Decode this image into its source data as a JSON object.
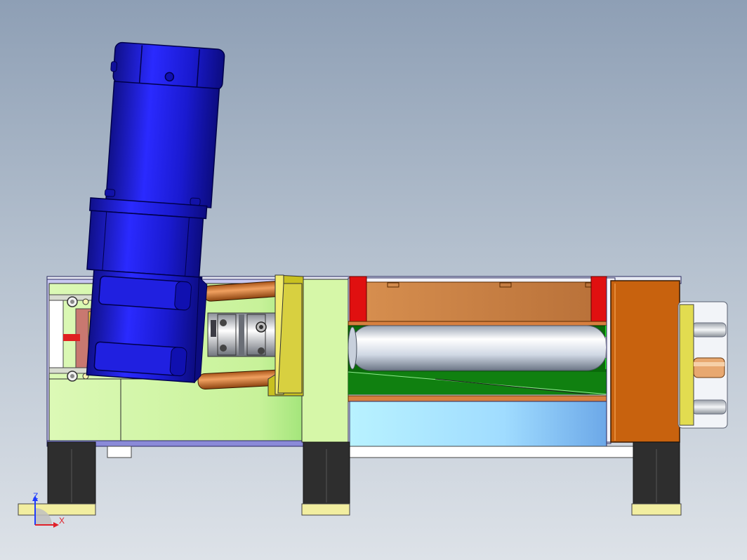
{
  "viewport": {
    "background_top": "#8e9fb5",
    "background_bottom": "#dde2e8"
  },
  "triad": {
    "z_label": "Z",
    "x_label": "X",
    "z_color": "#1f3cff",
    "x_color": "#e0202a"
  },
  "colors": {
    "motor_blue": "#1818c8",
    "frame_green": "#d6f7a8",
    "copper": "#c86a1c",
    "rail_red": "#e01010",
    "block_yellow": "#d8d040",
    "foot_dark": "#2e2e2e",
    "foot_pad": "#f2eea0",
    "cylinder_silver": "#e8eef5",
    "lower_cyan": "#a8e8ff",
    "slot_green": "#108010"
  }
}
